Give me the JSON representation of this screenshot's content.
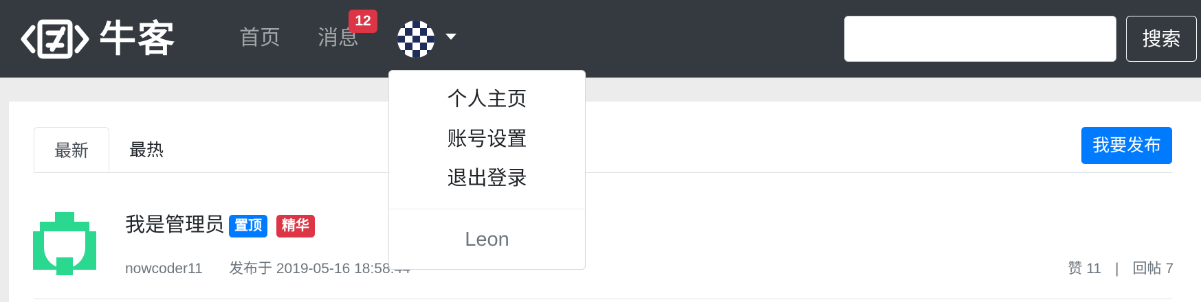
{
  "header": {
    "logo_text": "牛客",
    "nav": {
      "home": "首页",
      "messages": "消息",
      "message_count": "12"
    },
    "search": {
      "value": "",
      "button": "搜索"
    }
  },
  "user_menu": {
    "items": [
      "个人主页",
      "账号设置",
      "退出登录"
    ],
    "username": "Leon"
  },
  "main": {
    "tabs": [
      "最新",
      "最热"
    ],
    "publish_button": "我要发布",
    "posts": [
      {
        "title": "我是管理员",
        "tags": [
          "置顶",
          "精华"
        ],
        "author": "nowcoder11",
        "published": "发布于 2019-05-16 18:58:44",
        "likes": "赞 11",
        "separator": "|",
        "replies": "回帖 7"
      }
    ]
  },
  "colors": {
    "navbar": "#343a40",
    "primary": "#007bff",
    "danger": "#dc3545",
    "avatar_green": "#2ad98f"
  },
  "icons": [
    "nowcoder-logo-icon",
    "user-avatar-icon",
    "caret-down-icon",
    "post-avatar-icon"
  ]
}
